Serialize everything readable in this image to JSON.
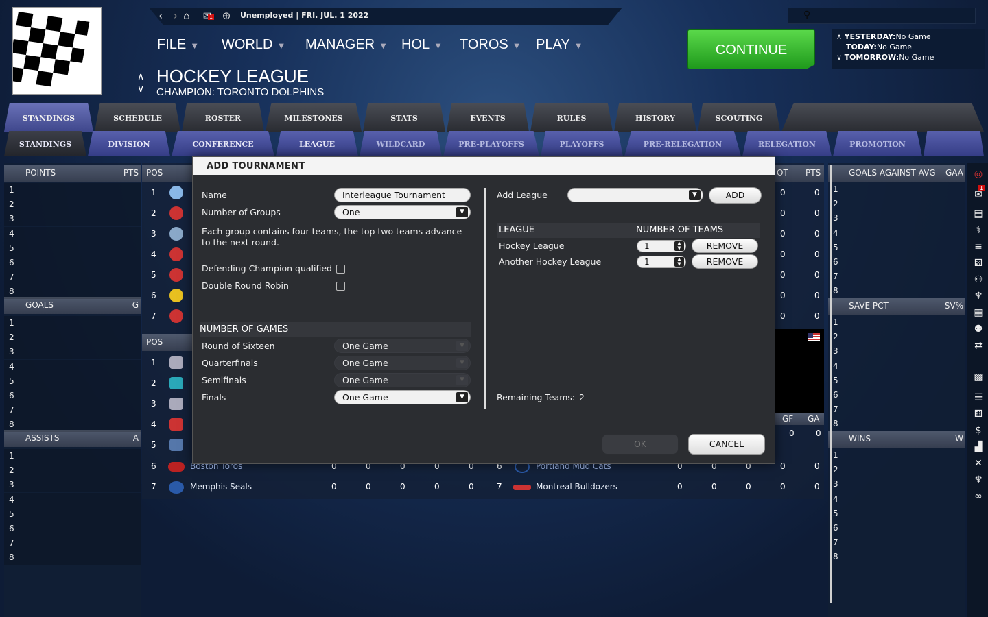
{
  "status": {
    "employment": "Unemployed |",
    "date": "FRI. JUL. 1 2022",
    "mail_count": "1"
  },
  "menu": [
    {
      "label": "FILE"
    },
    {
      "label": "WORLD"
    },
    {
      "label": "MANAGER"
    },
    {
      "label": "HOL"
    },
    {
      "label": "TOROS"
    },
    {
      "label": "PLAY"
    }
  ],
  "league": {
    "title": "HOCKEY LEAGUE",
    "champion": "CHAMPION: TORONTO DOLPHINS"
  },
  "continue_label": "CONTINUE",
  "schedule": {
    "yesterday_label": "YESTERDAY:",
    "yesterday_value": "No Game",
    "today_label": "TODAY:",
    "today_value": "No Game",
    "tomorrow_label": "TOMORROW:",
    "tomorrow_value": "No Game"
  },
  "tabs_top": [
    "STANDINGS",
    "SCHEDULE",
    "ROSTER",
    "MILESTONES",
    "STATS",
    "EVENTS",
    "RULES",
    "HISTORY",
    "SCOUTING"
  ],
  "tabs_sub": [
    "STANDINGS",
    "DIVISION",
    "CONFERENCE",
    "LEAGUE",
    "WILDCARD",
    "PRE-PLAYOFFS",
    "PLAYOFFS",
    "PRE-RELEGATION",
    "RELEGATION",
    "PROMOTION"
  ],
  "left_panels": [
    {
      "title": "POINTS",
      "abbr": "PTS"
    },
    {
      "title": "GOALS",
      "abbr": "G"
    },
    {
      "title": "ASSISTS",
      "abbr": "A"
    }
  ],
  "right_panels": [
    {
      "title": "GOALS AGAINST AVG",
      "abbr": "GAA"
    },
    {
      "title": "SAVE PCT",
      "abbr": "SV%"
    },
    {
      "title": "WINS",
      "abbr": "W"
    }
  ],
  "ranks": [
    "1",
    "2",
    "3",
    "4",
    "5",
    "6",
    "7",
    "8"
  ],
  "standings": {
    "pos_header": "POS",
    "ot_header": "OT",
    "pts_header": "PTS",
    "gf_header": "GF",
    "ga_header": "GA",
    "pos_numbers": [
      "1",
      "2",
      "3",
      "4",
      "5",
      "6",
      "7"
    ],
    "left_visible": [
      {
        "pos": "6",
        "team": "Boston Toros",
        "vals": [
          "0",
          "0",
          "0",
          "0",
          "0"
        ]
      },
      {
        "pos": "7",
        "team": "Memphis Seals",
        "vals": [
          "0",
          "0",
          "0",
          "0",
          "0"
        ]
      }
    ],
    "right_visible": [
      {
        "pos": "6",
        "team": "Portland Mud Cats",
        "vals": [
          "0",
          "0",
          "0",
          "0",
          "0"
        ]
      },
      {
        "pos": "7",
        "team": "Montreal Bulldozers",
        "vals": [
          "0",
          "0",
          "0",
          "0",
          "0"
        ]
      }
    ],
    "zero": "0"
  },
  "dialog": {
    "title": "ADD TOURNAMENT",
    "name_label": "Name",
    "name_value": "Interleague Tournament",
    "groups_label": "Number of Groups",
    "groups_value": "One",
    "description": "Each group contains four teams, the top two teams advance to the next round.",
    "defending_label": "Defending Champion qualified",
    "double_rr_label": "Double Round Robin",
    "games_header": "NUMBER OF GAMES",
    "rounds": [
      {
        "label": "Round of Sixteen",
        "value": "One Game",
        "enabled": false
      },
      {
        "label": "Quarterfinals",
        "value": "One Game",
        "enabled": false
      },
      {
        "label": "Semifinals",
        "value": "One Game",
        "enabled": false
      },
      {
        "label": "Finals",
        "value": "One Game",
        "enabled": true
      }
    ],
    "add_league_label": "Add League",
    "add_label": "ADD",
    "league_col": "LEAGUE",
    "teams_col": "NUMBER OF TEAMS",
    "leagues": [
      {
        "name": "Hockey League",
        "teams": "1",
        "remove": "REMOVE"
      },
      {
        "name": "Another Hockey League",
        "teams": "1",
        "remove": "REMOVE"
      }
    ],
    "remaining_label": "Remaining Teams:",
    "remaining_value": "2",
    "ok_label": "OK",
    "cancel_label": "CANCEL"
  }
}
